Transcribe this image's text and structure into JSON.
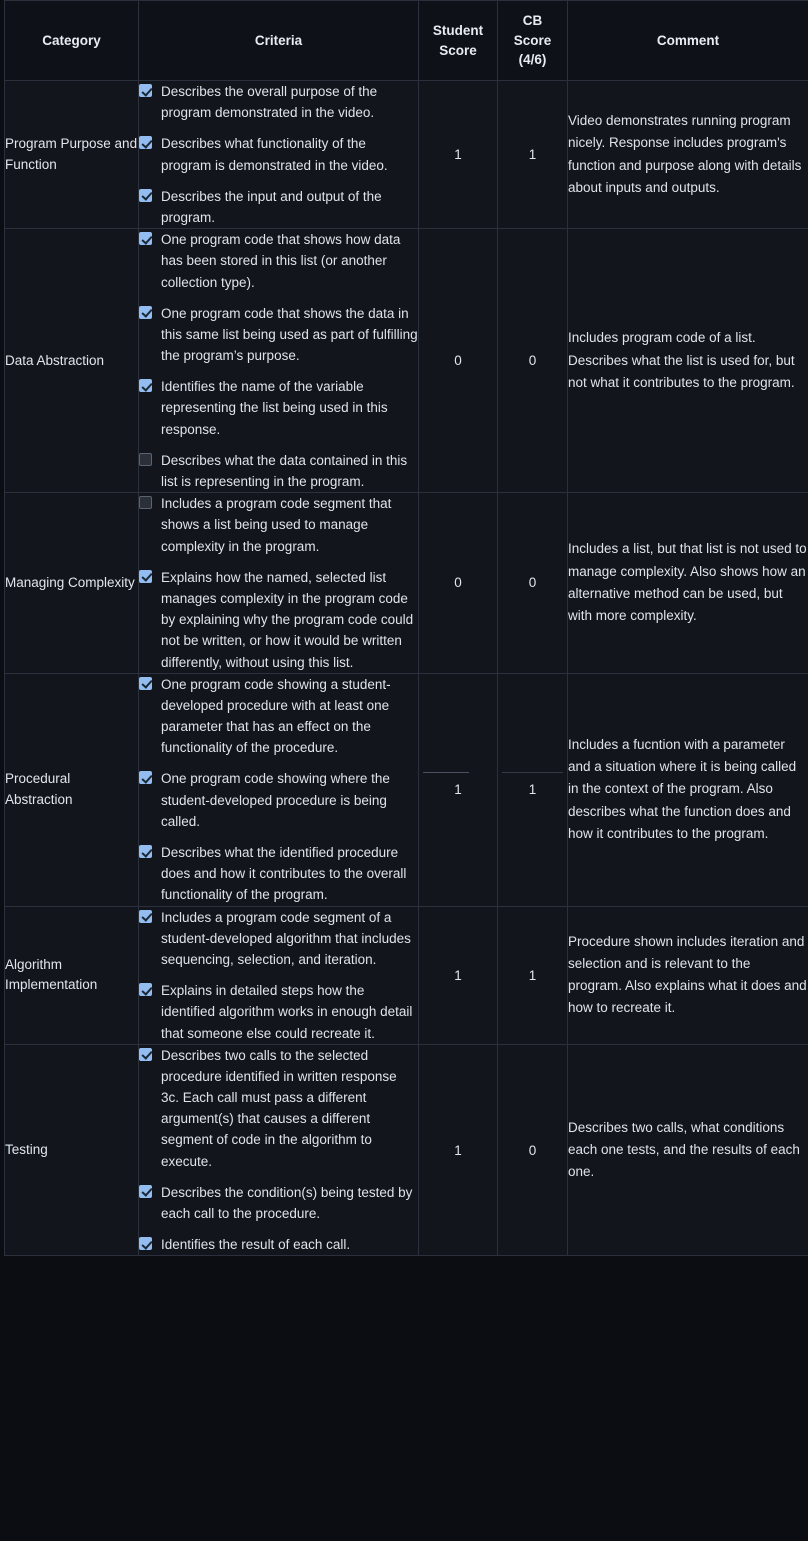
{
  "table": {
    "columns": [
      {
        "key": "category",
        "label": "Category"
      },
      {
        "key": "criteria",
        "label": "Criteria"
      },
      {
        "key": "student_score",
        "label": "Student\nScore"
      },
      {
        "key": "cb_score",
        "label": "CB\nScore\n(4/6)"
      },
      {
        "key": "comment",
        "label": "Comment"
      }
    ],
    "header": {
      "category": "Category",
      "criteria": "Criteria",
      "student_score_line1": "Student",
      "student_score_line2": "Score",
      "cb_score_line1": "CB",
      "cb_score_line2": "Score",
      "cb_score_line3": "(4/6)",
      "comment": "Comment"
    },
    "rows": [
      {
        "category": "Program Purpose and Function",
        "criteria": [
          {
            "checked": true,
            "text": "Describes the overall purpose of the program demonstrated in the video."
          },
          {
            "checked": true,
            "text": "Describes what functionality of the program is demonstrated in the video."
          },
          {
            "checked": true,
            "text": "Describes the input and output of the program."
          }
        ],
        "student_score": "1",
        "cb_score": "1",
        "comment": "Video demonstrates running program nicely. Response includes program's function and purpose along with details about inputs and outputs."
      },
      {
        "category": "Data Abstraction",
        "criteria": [
          {
            "checked": true,
            "text": "One program code that shows how data has been stored in this list (or another collection type)."
          },
          {
            "checked": true,
            "text": "One program code that shows the data in this same list being used as part of fulfilling the program’s purpose."
          },
          {
            "checked": true,
            "text": "Identifies the name of the variable representing the list being used in this response."
          },
          {
            "checked": false,
            "text": "Describes what the data contained in this list is representing in the program."
          }
        ],
        "student_score": "0",
        "cb_score": "0",
        "comment": "Includes program code of a list. Describes what the list is used for, but not what it contributes to the program."
      },
      {
        "category": "Managing Complexity",
        "criteria": [
          {
            "checked": false,
            "text": "Includes a program code segment that shows a list being used to manage complexity in the program."
          },
          {
            "checked": true,
            "text": "Explains how the named, selected list manages complexity in the program code by explaining why the program code could not be written, or how it would be written differently, without using this list."
          }
        ],
        "student_score": "0",
        "cb_score": "0",
        "comment": "Includes a list, but that list is not used to manage complexity. Also shows how an alternative method can be used, but with more complexity."
      },
      {
        "category": "Procedural Abstraction",
        "criteria": [
          {
            "checked": true,
            "text": "One program code showing a student-developed procedure with at least one parameter that has an effect on the functionality of the procedure."
          },
          {
            "checked": true,
            "text": "One program code showing where the student-developed procedure is being called."
          },
          {
            "checked": true,
            "text": "Describes what the identified procedure does and how it contributes to the overall functionality of the program."
          }
        ],
        "student_score": "1",
        "cb_score": "1",
        "comment": "Includes a fucntion with a parameter and a situation where it is being called in the context of the program. Also describes what the function does and how it contributes to the program."
      },
      {
        "category": "Algorithm Implementation",
        "criteria": [
          {
            "checked": true,
            "text": "Includes a program code segment of a student-developed algorithm that includes sequencing, selection, and iteration."
          },
          {
            "checked": true,
            "text": "Explains in detailed steps how the identified algorithm works in enough detail that someone else could recreate it."
          }
        ],
        "student_score": "1",
        "cb_score": "1",
        "comment": "Procedure shown includes iteration and selection and is relevant to the program. Also explains what it does and how to recreate it."
      },
      {
        "category": "Testing",
        "criteria": [
          {
            "checked": true,
            "text": "Describes two calls to the selected procedure identified in written response 3c. Each call must pass a different argument(s) that causes a different segment of code in the algorithm to execute."
          },
          {
            "checked": true,
            "text": "Describes the condition(s) being tested by each call to the procedure."
          },
          {
            "checked": true,
            "text": "Identifies the result of each call."
          }
        ],
        "student_score": "1",
        "cb_score": "0",
        "comment": "Describes two calls, what conditions each one tests, and the results of each one."
      }
    ]
  },
  "colors": {
    "background": "#0b0d12",
    "cell_background": "#12151c",
    "header_background": "#0e1117",
    "border": "#2b313c",
    "text": "#dfe4ea",
    "checkbox_checked": "#93bdf0",
    "checkbox_unchecked_border": "#5a6372"
  }
}
